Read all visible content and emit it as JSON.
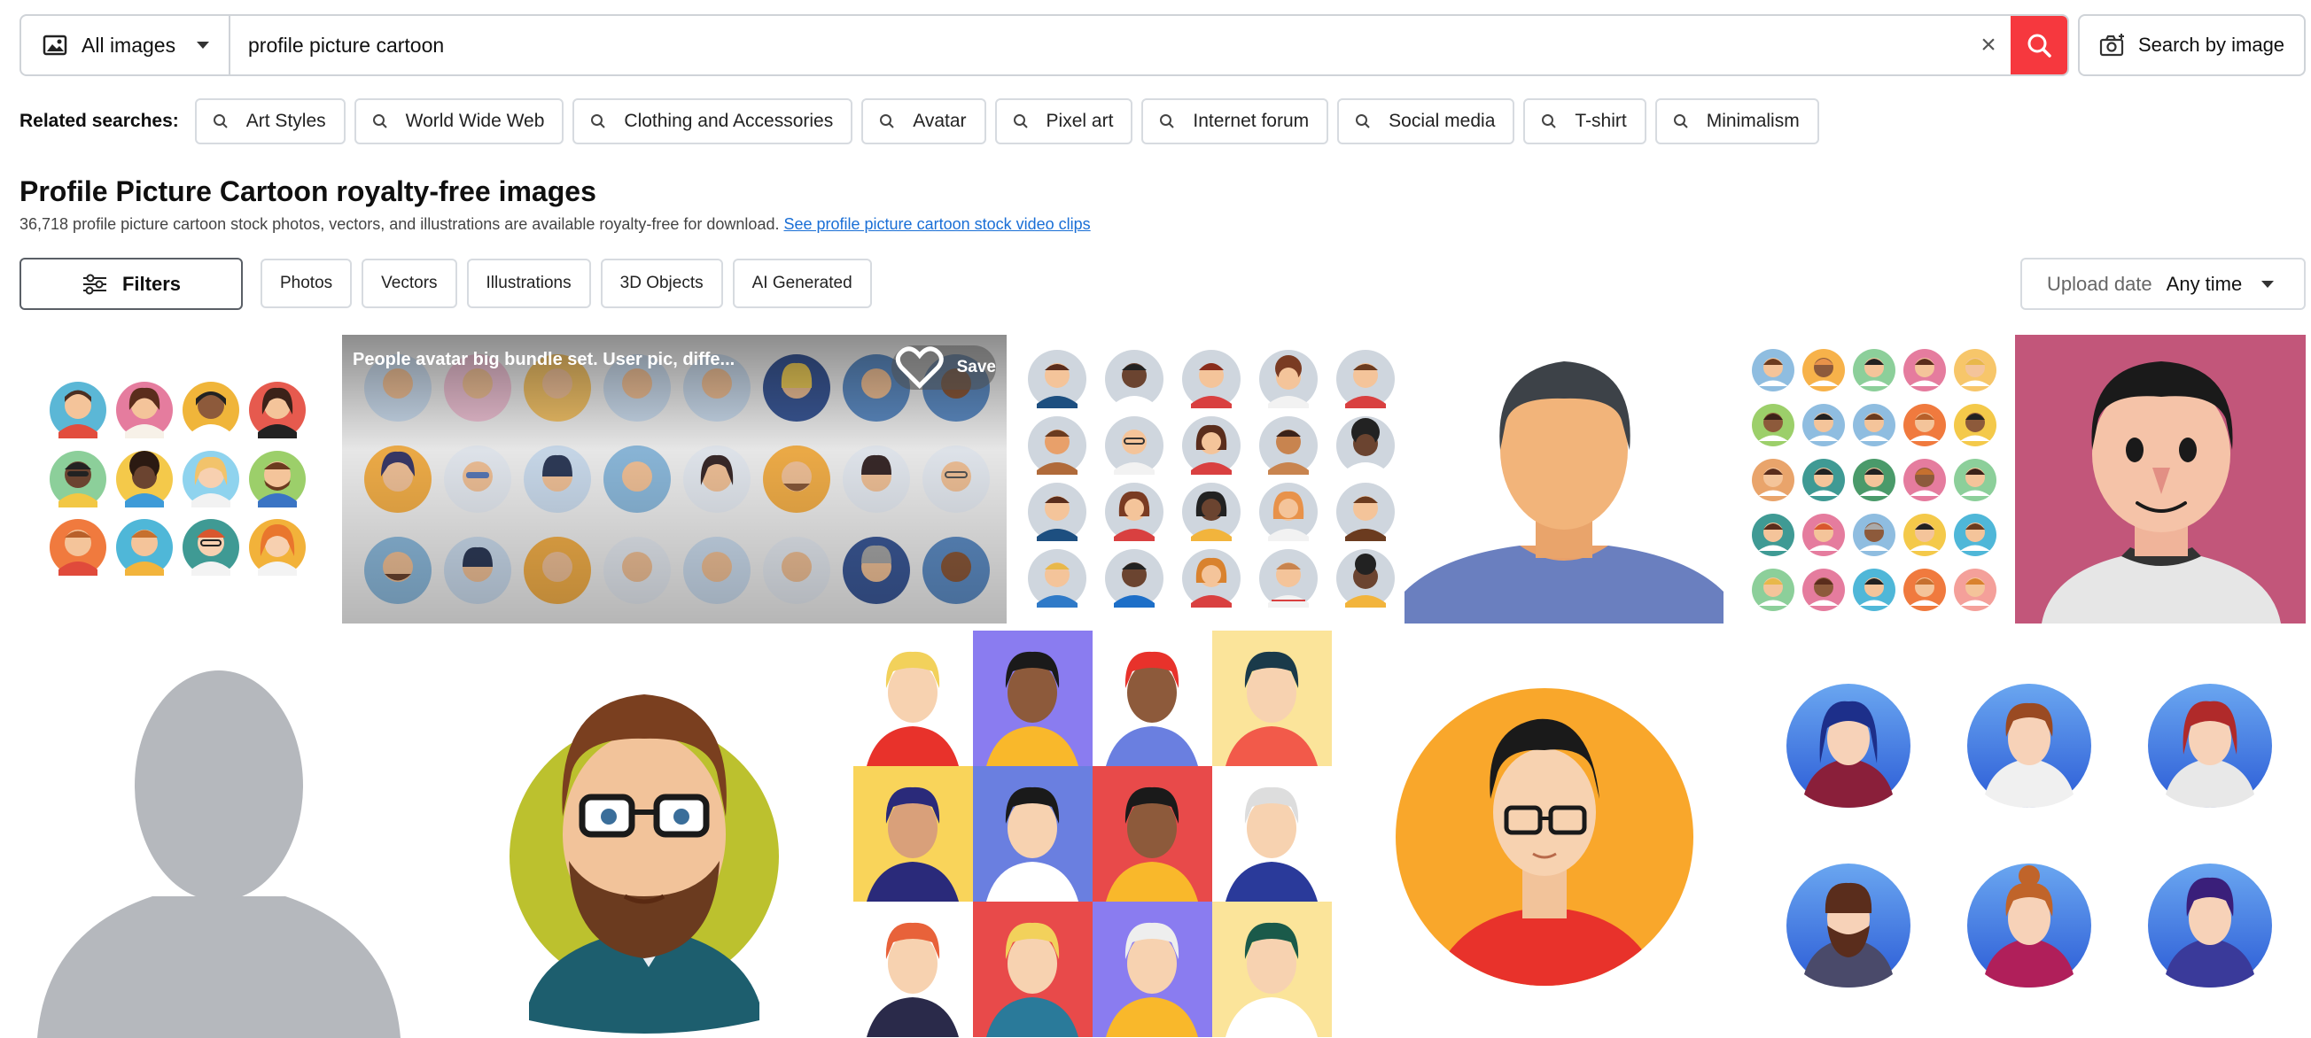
{
  "search": {
    "type_label": "All images",
    "query": "profile picture cartoon",
    "clear_symbol": "×",
    "by_image_label": "Search by image"
  },
  "related": {
    "label": "Related searches:",
    "items": [
      "Art Styles",
      "World Wide Web",
      "Clothing and Accessories",
      "Avatar",
      "Pixel art",
      "Internet forum",
      "Social media",
      "T-shirt",
      "Minimalism"
    ]
  },
  "heading": {
    "title": "Profile Picture Cartoon royalty-free images",
    "subtitle": "36,718 profile picture cartoon stock photos, vectors, and illustrations are available royalty-free for download.",
    "link": "See profile picture cartoon stock video clips"
  },
  "filters": {
    "label": "Filters",
    "types": [
      "Photos",
      "Vectors",
      "Illustrations",
      "3D Objects",
      "AI Generated"
    ],
    "upload_label": "Upload date",
    "upload_value": "Any time"
  },
  "results": {
    "hover_caption": "People avatar big bundle set. User pic, diffe...",
    "save_label": "Save"
  },
  "colors": {
    "accent": "#f6383e",
    "link": "#1a6fd6"
  }
}
